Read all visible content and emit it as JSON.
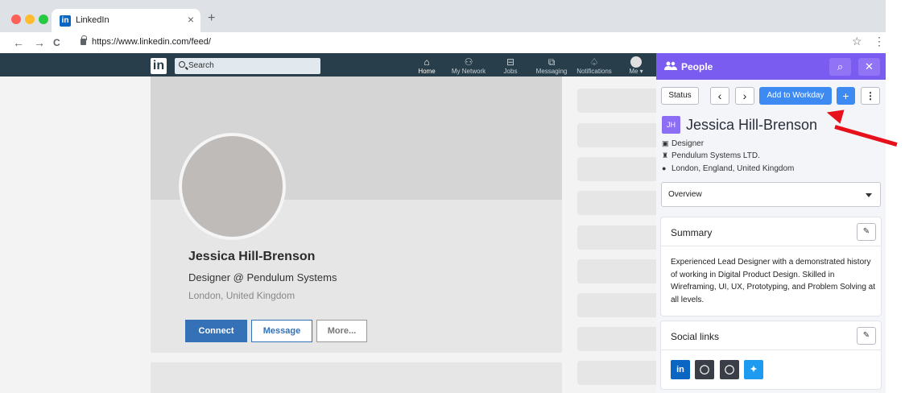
{
  "browser": {
    "tab_title": "LinkedIn",
    "tab_favicon": "in",
    "tab_close": "×",
    "new_tab": "+",
    "url": "https://www.linkedin.com/feed/",
    "back": "←",
    "forward": "→",
    "reload": "C",
    "star": "☆",
    "menu": "⋮",
    "traffic_colors": [
      "#fe5f57",
      "#febc2e",
      "#28c840"
    ]
  },
  "linkedin": {
    "logo": "in",
    "search_placeholder": "Search",
    "nav": [
      {
        "icon": "home-icon",
        "glyph": "⌂",
        "label": "Home"
      },
      {
        "icon": "my-network-icon",
        "glyph": "⚇",
        "label": "My Network"
      },
      {
        "icon": "jobs-icon",
        "glyph": "⊟",
        "label": "Jobs"
      },
      {
        "icon": "messaging-icon",
        "glyph": "⧉",
        "label": "Messaging"
      },
      {
        "icon": "notifications-icon",
        "glyph": "♤",
        "label": "Notifications"
      },
      {
        "icon": "me-avatar",
        "glyph": "",
        "label": "Me ▾"
      }
    ],
    "profile": {
      "name": "Jessica Hill-Brenson",
      "headline": "Designer @ Pendulum Systems",
      "location": "London, United Kingdom",
      "connect": "Connect",
      "message": "Message",
      "more": "More..."
    },
    "colors": {
      "header": "#283e4a",
      "primary": "#3471b7"
    }
  },
  "panel": {
    "title": "People",
    "title_icon": "people-icon",
    "search_glyph": "⌕",
    "close_glyph": "✕",
    "status": "Status",
    "prev": "‹",
    "next": "›",
    "add_to_workday": "Add to Workday",
    "add_glyph": "+",
    "more_glyph": "⋮",
    "initials": "JH",
    "name": "Jessica Hill-Brenson",
    "role": "Designer",
    "company": "Pendulum Systems LTD.",
    "location": "London, England, United Kingdom",
    "overview": "Overview",
    "summary_title": "Summary",
    "summary_text": "Experienced Lead Designer with a demonstrated history of working in Digital Product Design. Skilled in Wireframing, UI, UX, Prototyping, and Problem Solving at all levels.",
    "social_title": "Social links",
    "edit_glyph": "✎",
    "social": [
      {
        "icon": "linkedin-icon",
        "glyph": "in",
        "color": "#0a66c2"
      },
      {
        "icon": "github-icon",
        "glyph": "◯",
        "color": "#3a3f47"
      },
      {
        "icon": "github-icon",
        "glyph": "◯",
        "color": "#3a3f47"
      },
      {
        "icon": "twitter-icon",
        "glyph": "✦",
        "color": "#1d9bf0"
      }
    ],
    "colors": {
      "header": "#7a5cf0",
      "accent": "#3d8bf2"
    }
  }
}
